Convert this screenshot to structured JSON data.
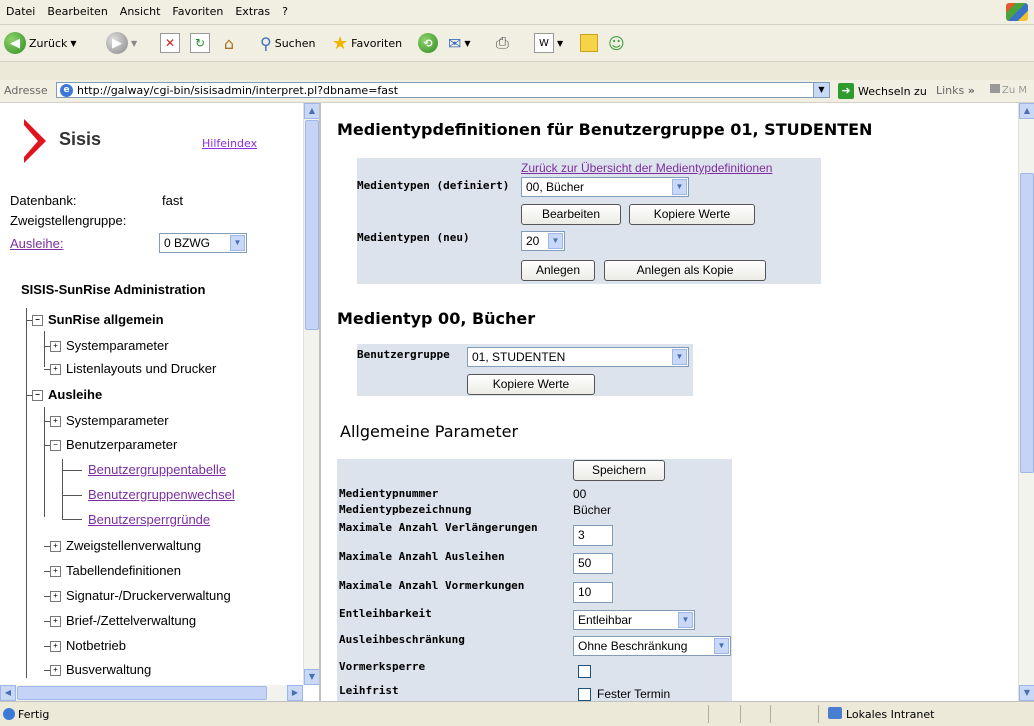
{
  "menu": [
    "Datei",
    "Bearbeiten",
    "Ansicht",
    "Favoriten",
    "Extras",
    "?"
  ],
  "toolbar": {
    "back": "Zurück",
    "search": "Suchen",
    "favorites": "Favoriten"
  },
  "address": {
    "label": "Adresse",
    "url": "http://galway/cgi-bin/sisisadmin/interpret.pl?dbname=fast",
    "go": "Wechseln zu",
    "links": "Links",
    "extra": "Zu M"
  },
  "left": {
    "logo": "Sisis",
    "help": "Hilfeindex",
    "db_label": "Datenbank:",
    "db_value": "fast",
    "branch_label": "Zweigstellengruppe:",
    "loan_link": "Ausleihe:",
    "loan_select": "0 BZWG",
    "admin_title": "SISIS-SunRise Administration",
    "tree": [
      "SunRise allgemein",
      "Systemparameter",
      "Listenlayouts und Drucker",
      "Ausleihe",
      "Systemparameter",
      "Benutzerparameter",
      "Benutzergruppentabelle",
      "Benutzergruppenwechsel",
      "Benutzersperrgründe",
      "Zweigstellenverwaltung",
      "Tabellendefinitionen",
      "Signatur-/Druckerverwaltung",
      "Brief-/Zettelverwaltung",
      "Notbetrieb",
      "Busverwaltung"
    ]
  },
  "main": {
    "title": "Medientypdefinitionen für Benutzergruppe 01, STUDENTEN",
    "back_link": "Zurück zur Übersicht der Medientypdefinitionen",
    "defined_label": "Medientypen (definiert)",
    "defined_select": "00, Bücher",
    "edit_btn": "Bearbeiten",
    "copy_values_btn": "Kopiere Werte",
    "new_label": "Medientypen (neu)",
    "new_select": "20",
    "create_btn": "Anlegen",
    "create_copy_btn": "Anlegen als Kopie",
    "mt_title": "Medientyp 00, Bücher",
    "group_label": "Benutzergruppe",
    "group_select": "01, STUDENTEN",
    "copy_values_btn2": "Kopiere Werte",
    "general_title": "Allgemeine Parameter",
    "save_btn": "Speichern",
    "fields": {
      "nr_label": "Medientypnummer",
      "nr_value": "00",
      "name_label": "Medientypbezeichnung",
      "name_value": "Bücher",
      "ext_label": "Maximale Anzahl Verlängerungen",
      "ext_value": "3",
      "loans_label": "Maximale Anzahl Ausleihen",
      "loans_value": "50",
      "res_label": "Maximale Anzahl Vormerkungen",
      "res_value": "10",
      "lend_label": "Entleihbarkeit",
      "lend_value": "Entleihbar",
      "restr_label": "Ausleihbeschränkung",
      "restr_value": "Ohne Beschränkung",
      "block_label": "Vormerksperre",
      "period_label": "Leihfrist",
      "fixed_label": "Fester Termin"
    }
  },
  "status": {
    "text": "Fertig",
    "zone": "Lokales Intranet"
  }
}
